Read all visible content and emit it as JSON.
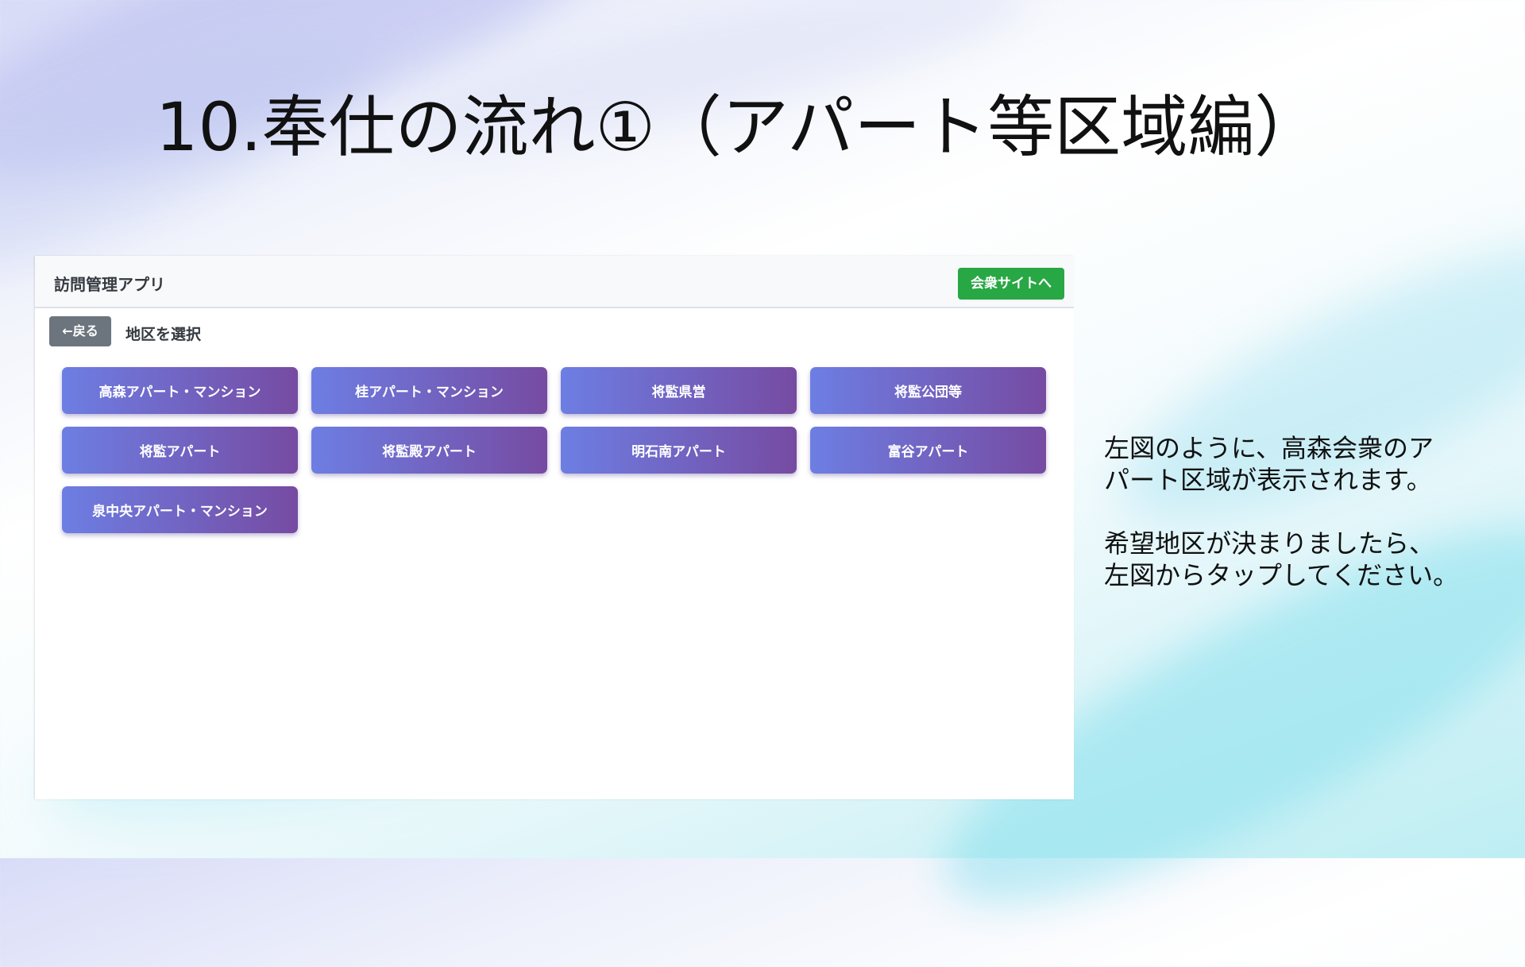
{
  "slide": {
    "title": "10.奉仕の流れ①（アパート等区域編）"
  },
  "app": {
    "title": "訪問管理アプリ",
    "site_button_label": "会衆サイトへ",
    "back_button_label": "←戻る",
    "section_label": "地区を選択",
    "districts": [
      "高森アパート・マンション",
      "桂アパート・マンション",
      "将監県営",
      "将監公団等",
      "将監アパート",
      "将監殿アパート",
      "明石南アパート",
      "富谷アパート",
      "泉中央アパート・マンション"
    ]
  },
  "explanation": {
    "paragraph1": "左図のように、高森会衆のア\nパート区域が表示されます。",
    "paragraph2": "希望地区が決まりましたら、\n左図からタップしてください。"
  },
  "colors": {
    "site_button": "#28a745",
    "back_button": "#6c757d",
    "district_gradient_start": "#6d7ee3",
    "district_gradient_end": "#764ba2"
  }
}
